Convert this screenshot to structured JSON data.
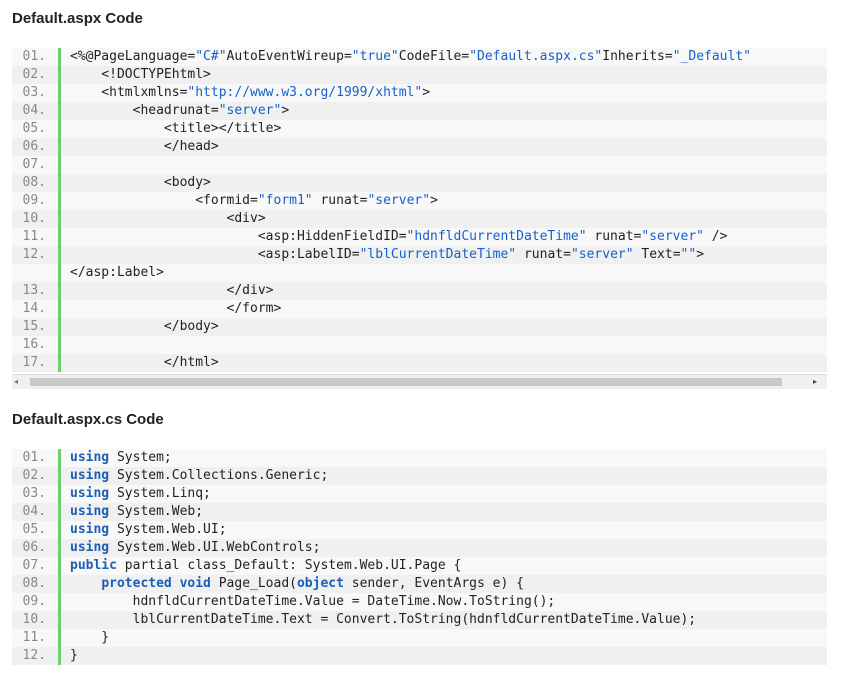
{
  "sections": [
    {
      "title": "Default.aspx Code",
      "lines": [
        {
          "n": "01.",
          "t": [
            [
              "p",
              "<%@PageLanguage="
            ],
            [
              "s",
              "\"C#\""
            ],
            [
              "p",
              "AutoEventWireup="
            ],
            [
              "s",
              "\"true\""
            ],
            [
              "p",
              "CodeFile="
            ],
            [
              "s",
              "\"Default.aspx.cs\""
            ],
            [
              "p",
              "Inherits="
            ],
            [
              "s",
              "\"_Default\""
            ]
          ]
        },
        {
          "n": "02.",
          "t": [
            [
              "p",
              "    <!DOCTYPEhtml>"
            ]
          ]
        },
        {
          "n": "03.",
          "t": [
            [
              "p",
              "    <htmlxmlns="
            ],
            [
              "s",
              "\"http://www.w3.org/1999/xhtml\""
            ],
            [
              "p",
              ">"
            ]
          ]
        },
        {
          "n": "04.",
          "t": [
            [
              "p",
              "        <headrunat="
            ],
            [
              "s",
              "\"server\""
            ],
            [
              "p",
              ">"
            ]
          ]
        },
        {
          "n": "05.",
          "t": [
            [
              "p",
              "            <title></title>"
            ]
          ]
        },
        {
          "n": "06.",
          "t": [
            [
              "p",
              "            </head>"
            ]
          ]
        },
        {
          "n": "07.",
          "t": []
        },
        {
          "n": "08.",
          "t": [
            [
              "p",
              "            <body>"
            ]
          ]
        },
        {
          "n": "09.",
          "t": [
            [
              "p",
              "                <formid="
            ],
            [
              "s",
              "\"form1\""
            ],
            [
              "p",
              " runat="
            ],
            [
              "s",
              "\"server\""
            ],
            [
              "p",
              ">"
            ]
          ]
        },
        {
          "n": "10.",
          "t": [
            [
              "p",
              "                    <div>"
            ]
          ]
        },
        {
          "n": "11.",
          "t": [
            [
              "p",
              "                        <asp:HiddenFieldID="
            ],
            [
              "s",
              "\"hdnfldCurrentDateTime\""
            ],
            [
              "p",
              " runat="
            ],
            [
              "s",
              "\"server\""
            ],
            [
              "p",
              " />"
            ]
          ]
        },
        {
          "n": "12.",
          "t": [
            [
              "p",
              "                        <asp:LabelID="
            ],
            [
              "s",
              "\"lblCurrentDateTime\""
            ],
            [
              "p",
              " runat="
            ],
            [
              "s",
              "\"server\""
            ],
            [
              "p",
              " Text="
            ],
            [
              "s",
              "\"\""
            ],
            [
              "p",
              ">"
            ]
          ]
        },
        {
          "n": "",
          "t": [
            [
              "p",
              "</asp:Label>"
            ]
          ]
        },
        {
          "n": "13.",
          "t": [
            [
              "p",
              "                    </div>"
            ]
          ]
        },
        {
          "n": "14.",
          "t": [
            [
              "p",
              "                    </form>"
            ]
          ]
        },
        {
          "n": "15.",
          "t": [
            [
              "p",
              "            </body>"
            ]
          ]
        },
        {
          "n": "16.",
          "t": []
        },
        {
          "n": "17.",
          "t": [
            [
              "p",
              "            </html>"
            ]
          ]
        }
      ]
    },
    {
      "title": "Default.aspx.cs Code",
      "lines": [
        {
          "n": "01.",
          "t": [
            [
              "k",
              "using"
            ],
            [
              "p",
              " System;"
            ]
          ]
        },
        {
          "n": "02.",
          "t": [
            [
              "k",
              "using"
            ],
            [
              "p",
              " System.Collections.Generic;"
            ]
          ]
        },
        {
          "n": "03.",
          "t": [
            [
              "k",
              "using"
            ],
            [
              "p",
              " System.Linq;"
            ]
          ]
        },
        {
          "n": "04.",
          "t": [
            [
              "k",
              "using"
            ],
            [
              "p",
              " System.Web;"
            ]
          ]
        },
        {
          "n": "05.",
          "t": [
            [
              "k",
              "using"
            ],
            [
              "p",
              " System.Web.UI;"
            ]
          ]
        },
        {
          "n": "06.",
          "t": [
            [
              "k",
              "using"
            ],
            [
              "p",
              " System.Web.UI.WebControls;"
            ]
          ]
        },
        {
          "n": "07.",
          "t": [
            [
              "k",
              "public"
            ],
            [
              "p",
              " partial class_Default: System.Web.UI.Page {"
            ]
          ]
        },
        {
          "n": "08.",
          "t": [
            [
              "p",
              "    "
            ],
            [
              "k",
              "protected void"
            ],
            [
              "p",
              " Page_Load("
            ],
            [
              "k",
              "object"
            ],
            [
              "p",
              " sender, EventArgs e) {"
            ]
          ]
        },
        {
          "n": "09.",
          "t": [
            [
              "p",
              "        hdnfldCurrentDateTime.Value = DateTime.Now.ToString();"
            ]
          ]
        },
        {
          "n": "10.",
          "t": [
            [
              "p",
              "        lblCurrentDateTime.Text = Convert.ToString(hdnfldCurrentDateTime.Value);"
            ]
          ]
        },
        {
          "n": "11.",
          "t": [
            [
              "p",
              "    }"
            ]
          ]
        },
        {
          "n": "12.",
          "t": [
            [
              "p",
              "}"
            ]
          ]
        }
      ]
    }
  ],
  "scrollbar": {
    "left_arrow": "◂",
    "right_arrow": "▸"
  },
  "colors": {
    "keyword": "#1a5fb4",
    "string": "#1560cc",
    "gutter": "#6ccf6c"
  }
}
